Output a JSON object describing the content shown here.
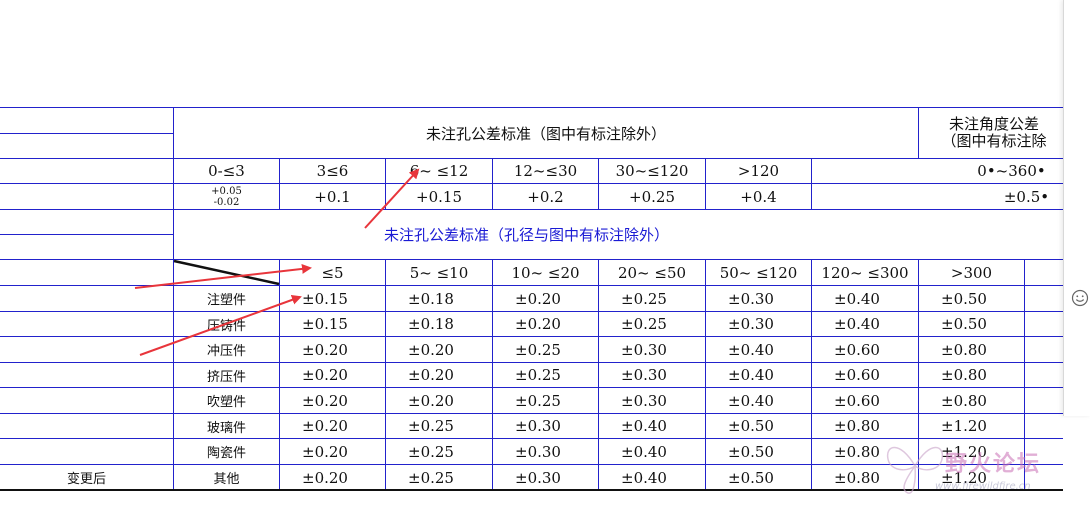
{
  "table1": {
    "title": "未注孔公差标准（图中有标注除外）",
    "angle_title_line1": "未注角度公差",
    "angle_title_line2": "（图中有标注除",
    "ranges": [
      "0-≤3",
      "3≤6",
      "6~ ≤12",
      "12~≤30",
      "30~≤120",
      ">120"
    ],
    "angle_range": "0•~360•",
    "tol_first_upper": "+0.05",
    "tol_first_lower": "-0.02",
    "tolerances": [
      "+0.1",
      "+0.15",
      "+0.2",
      "+0.25",
      "+0.4"
    ],
    "angle_tol": "±0.5•"
  },
  "table2": {
    "title": "未注孔公差标准（孔径与图中有标注除外）",
    "title_color": "#1a1ad4",
    "headers": [
      "≤5",
      "5~ ≤10",
      "10~ ≤20",
      "20~ ≤50",
      "50~ ≤120",
      "120~ ≤300",
      ">300"
    ],
    "rows": [
      {
        "name": "注塑件",
        "values": [
          "±0.15",
          "±0.18",
          "±0.20",
          "±0.25",
          "±0.30",
          "±0.40",
          "±0.50"
        ]
      },
      {
        "name": "压铸件",
        "values": [
          "±0.15",
          "±0.18",
          "±0.20",
          "±0.25",
          "±0.30",
          "±0.40",
          "±0.50"
        ]
      },
      {
        "name": "冲压件",
        "values": [
          "±0.20",
          "±0.20",
          "±0.25",
          "±0.30",
          "±0.40",
          "±0.60",
          "±0.80"
        ]
      },
      {
        "name": "挤压件",
        "values": [
          "±0.20",
          "±0.20",
          "±0.25",
          "±0.30",
          "±0.40",
          "±0.60",
          "±0.80"
        ]
      },
      {
        "name": "吹塑件",
        "values": [
          "±0.20",
          "±0.20",
          "±0.25",
          "±0.30",
          "±0.40",
          "±0.60",
          "±0.80"
        ]
      },
      {
        "name": "玻璃件",
        "values": [
          "±0.20",
          "±0.25",
          "±0.30",
          "±0.40",
          "±0.50",
          "±0.80",
          "±1.20"
        ]
      },
      {
        "name": "陶瓷件",
        "values": [
          "±0.20",
          "±0.25",
          "±0.30",
          "±0.40",
          "±0.50",
          "±0.80",
          "±1.20"
        ]
      },
      {
        "name": "其他",
        "values": [
          "±0.20",
          "±0.25",
          "±0.30",
          "±0.40",
          "±0.50",
          "±0.80",
          "±1.20"
        ]
      }
    ]
  },
  "left_label": "变更后",
  "watermark": {
    "text": "野火论坛",
    "url": "www.firewildfire.cn"
  },
  "colors": {
    "grid": "#2222cc",
    "arrow": "#e8353b"
  },
  "icons": {
    "side_panel": "smiley-icon"
  }
}
